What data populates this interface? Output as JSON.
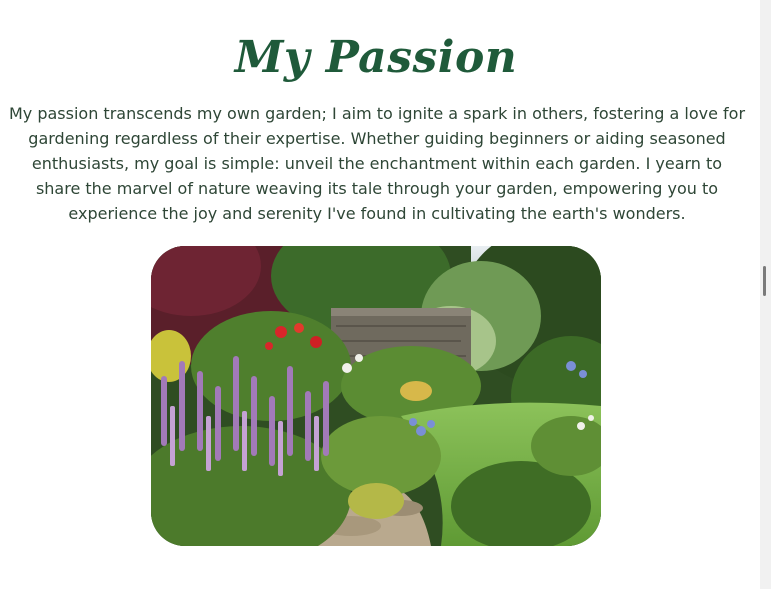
{
  "section": {
    "title": "My Passion",
    "paragraph": "My passion transcends my own garden; I aim to ignite a spark in others, fostering a love for gardening regardless of their expertise. Whether guiding beginners or aiding seasoned enthusiasts, my goal is simple: unveil the enchantment within each garden. I yearn to share the marvel of nature weaving its tale through your garden, empowering you to experience the joy and serenity I've found in cultivating the earth's wonders."
  },
  "colors": {
    "title": "#1f5a3a",
    "text": "#2e4636",
    "background": "#ffffff"
  },
  "icons": {
    "image": "garden-photo"
  }
}
